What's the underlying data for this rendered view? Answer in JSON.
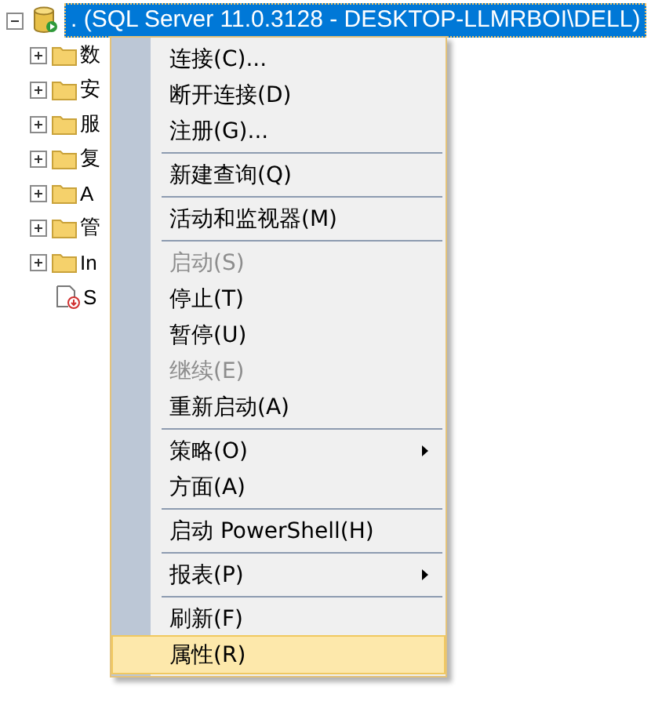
{
  "tree": {
    "root": {
      "label": ". (SQL Server 11.0.3128 - DESKTOP-LLMRBOI\\DELL)",
      "expanded": true,
      "selected": true
    },
    "children": [
      {
        "label": "数",
        "kind": "folder"
      },
      {
        "label": "安",
        "kind": "folder"
      },
      {
        "label": "服",
        "kind": "folder"
      },
      {
        "label": "复",
        "kind": "folder"
      },
      {
        "label": "A",
        "kind": "folder"
      },
      {
        "label": "管",
        "kind": "folder"
      },
      {
        "label": "In",
        "kind": "folder"
      },
      {
        "label": "S",
        "kind": "log"
      }
    ]
  },
  "context_menu": {
    "items": [
      {
        "kind": "item",
        "label": "连接(C)...",
        "disabled": false,
        "submenu": false,
        "selected": false
      },
      {
        "kind": "item",
        "label": "断开连接(D)",
        "disabled": false,
        "submenu": false,
        "selected": false
      },
      {
        "kind": "item",
        "label": "注册(G)...",
        "disabled": false,
        "submenu": false,
        "selected": false
      },
      {
        "kind": "separator"
      },
      {
        "kind": "item",
        "label": "新建查询(Q)",
        "disabled": false,
        "submenu": false,
        "selected": false
      },
      {
        "kind": "separator"
      },
      {
        "kind": "item",
        "label": "活动和监视器(M)",
        "disabled": false,
        "submenu": false,
        "selected": false
      },
      {
        "kind": "separator"
      },
      {
        "kind": "item",
        "label": "启动(S)",
        "disabled": true,
        "submenu": false,
        "selected": false
      },
      {
        "kind": "item",
        "label": "停止(T)",
        "disabled": false,
        "submenu": false,
        "selected": false
      },
      {
        "kind": "item",
        "label": "暂停(U)",
        "disabled": false,
        "submenu": false,
        "selected": false
      },
      {
        "kind": "item",
        "label": "继续(E)",
        "disabled": true,
        "submenu": false,
        "selected": false
      },
      {
        "kind": "item",
        "label": "重新启动(A)",
        "disabled": false,
        "submenu": false,
        "selected": false
      },
      {
        "kind": "separator"
      },
      {
        "kind": "item",
        "label": "策略(O)",
        "disabled": false,
        "submenu": true,
        "selected": false
      },
      {
        "kind": "item",
        "label": "方面(A)",
        "disabled": false,
        "submenu": false,
        "selected": false
      },
      {
        "kind": "separator"
      },
      {
        "kind": "item",
        "label": "启动 PowerShell(H)",
        "disabled": false,
        "submenu": false,
        "selected": false
      },
      {
        "kind": "separator"
      },
      {
        "kind": "item",
        "label": "报表(P)",
        "disabled": false,
        "submenu": true,
        "selected": false
      },
      {
        "kind": "separator"
      },
      {
        "kind": "item",
        "label": "刷新(F)",
        "disabled": false,
        "submenu": false,
        "selected": false
      },
      {
        "kind": "item",
        "label": "属性(R)",
        "disabled": false,
        "submenu": false,
        "selected": true
      }
    ]
  }
}
